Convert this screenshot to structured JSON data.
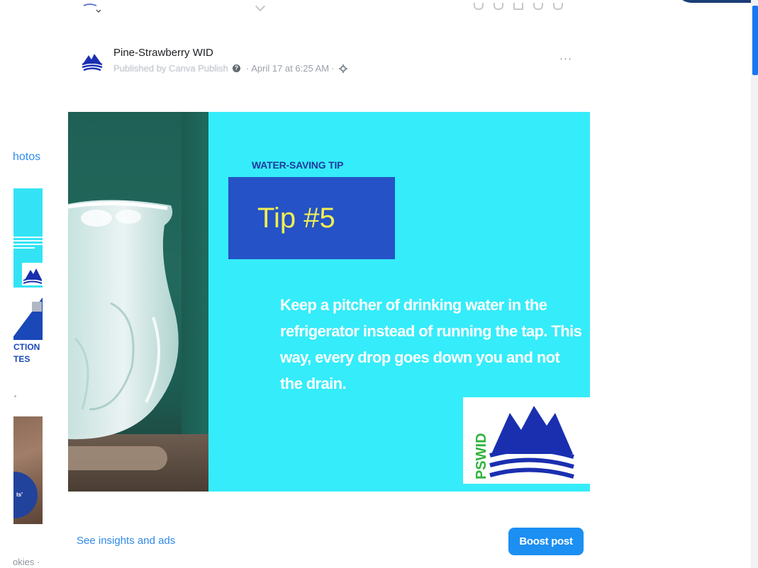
{
  "left_column": {
    "photos_label": "hotos",
    "thumb2_text": "CTION\nTES",
    "thumb3_text": "ts'",
    "cookies_label": "okies ·"
  },
  "post": {
    "page_name": "Pine-Strawberry WID",
    "published_by": "Published by Canva Publish",
    "timestamp": "April 17 at 6:25 AM",
    "more_label": "···",
    "image": {
      "tip_label": "WATER-SAVING TIP",
      "tip_number": "Tip #5",
      "tip_text": "Keep a pitcher of drinking water in the refrigerator instead of running the tap. This way, every drop goes down you and not the drain.",
      "logo_text": "PSWID"
    }
  },
  "footer": {
    "insights_label": "See insights and ads",
    "boost_label": "Boost post"
  },
  "colors": {
    "image_bg": "#35ecfa",
    "tip_box": "#2552c6",
    "tip_number": "#f2ee52",
    "boost_button": "#1b8ff2",
    "link": "#2f8ae8",
    "logo_blue": "#1a2fb0",
    "logo_green": "#2fb33d"
  }
}
